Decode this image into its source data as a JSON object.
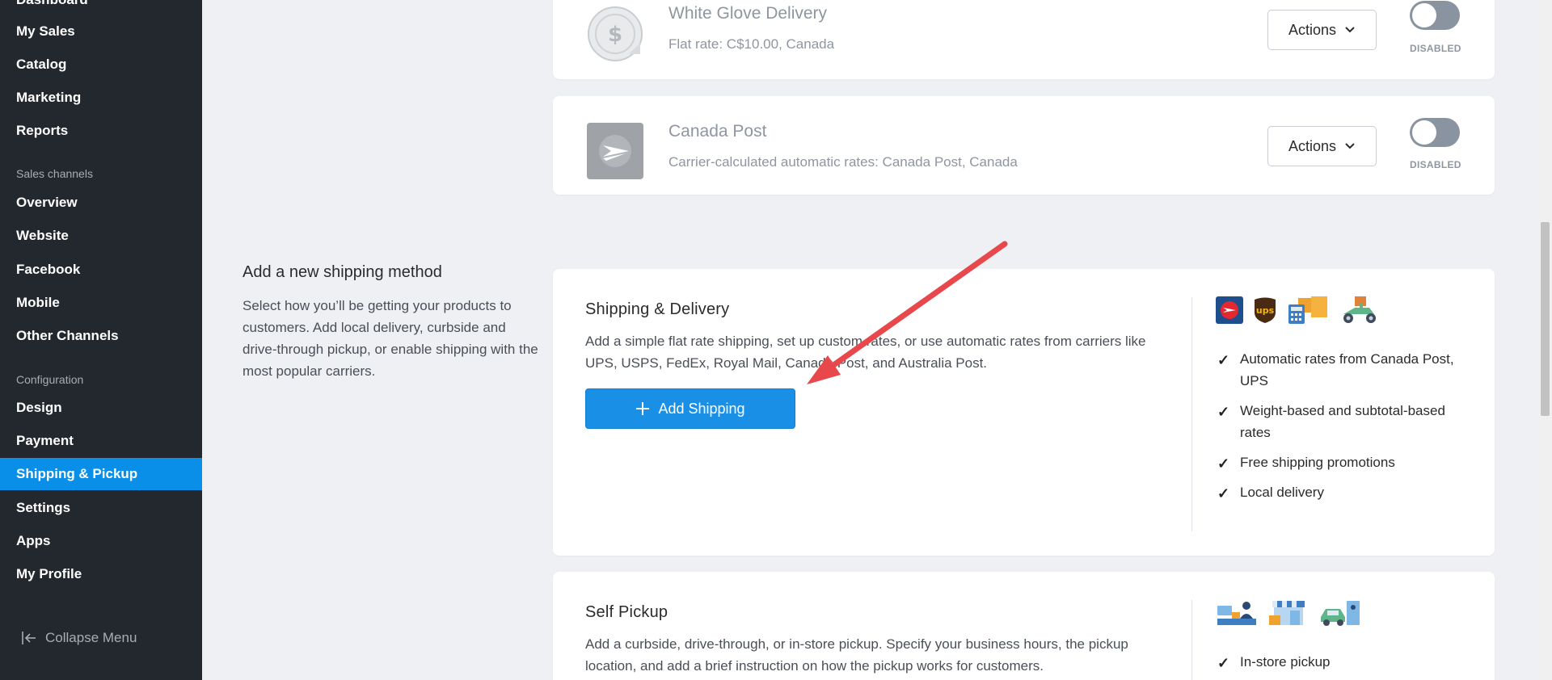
{
  "sidebar": {
    "items_top": [
      "Dashboard",
      "My Sales",
      "Catalog",
      "Marketing",
      "Reports"
    ],
    "sales_channels_label": "Sales channels",
    "sales_channels": [
      "Overview",
      "Website",
      "Facebook",
      "Mobile",
      "Other Channels"
    ],
    "configuration_label": "Configuration",
    "configuration": [
      "Design",
      "Payment",
      "Shipping & Pickup",
      "Settings",
      "Apps",
      "My Profile"
    ],
    "active_item": "Shipping & Pickup",
    "collapse_label": "Collapse Menu"
  },
  "methods": [
    {
      "title": "White Glove Delivery",
      "subtitle": "Flat rate: C$10.00, Canada",
      "actions_label": "Actions",
      "status": "DISABLED",
      "icon": "dollar-sticker-icon"
    },
    {
      "title": "Canada Post",
      "subtitle": "Carrier-calculated automatic rates: Canada Post, Canada",
      "actions_label": "Actions",
      "status": "DISABLED",
      "icon": "canada-post-logo"
    }
  ],
  "intro": {
    "title": "Add a new shipping method",
    "text": "Select how you’ll be getting your products to customers. Add local delivery, curbside and drive-through pickup, or enable shipping with the most popular carriers."
  },
  "shipping_card": {
    "title": "Shipping & Delivery",
    "text": "Add a simple flat rate shipping, set up custom rates, or use automatic rates from carriers like UPS, USPS, FedEx, Royal Mail, Canada Post, and Australia Post.",
    "button_label": "Add Shipping",
    "features": [
      "Automatic rates from Canada Post, UPS",
      "Weight-based and subtotal-based rates",
      "Free shipping promotions",
      "Local delivery"
    ],
    "icons": [
      "canada-post-icon",
      "ups-icon",
      "calculator-boxes-icon",
      "delivery-scooter-icon"
    ]
  },
  "pickup_card": {
    "title": "Self Pickup",
    "text": "Add a curbside, drive-through, or in-store pickup. Specify your business hours, the pickup location, and add a brief instruction on how the pickup works for customers.",
    "features": [
      "In-store pickup"
    ],
    "icons": [
      "store-counter-icon",
      "storefront-icon",
      "car-pickup-icon"
    ]
  },
  "colors": {
    "sidebar_bg": "#23272e",
    "active_item": "#0a8fe8",
    "primary_button": "#1a8fe6",
    "annotation_arrow": "#e8474c"
  }
}
